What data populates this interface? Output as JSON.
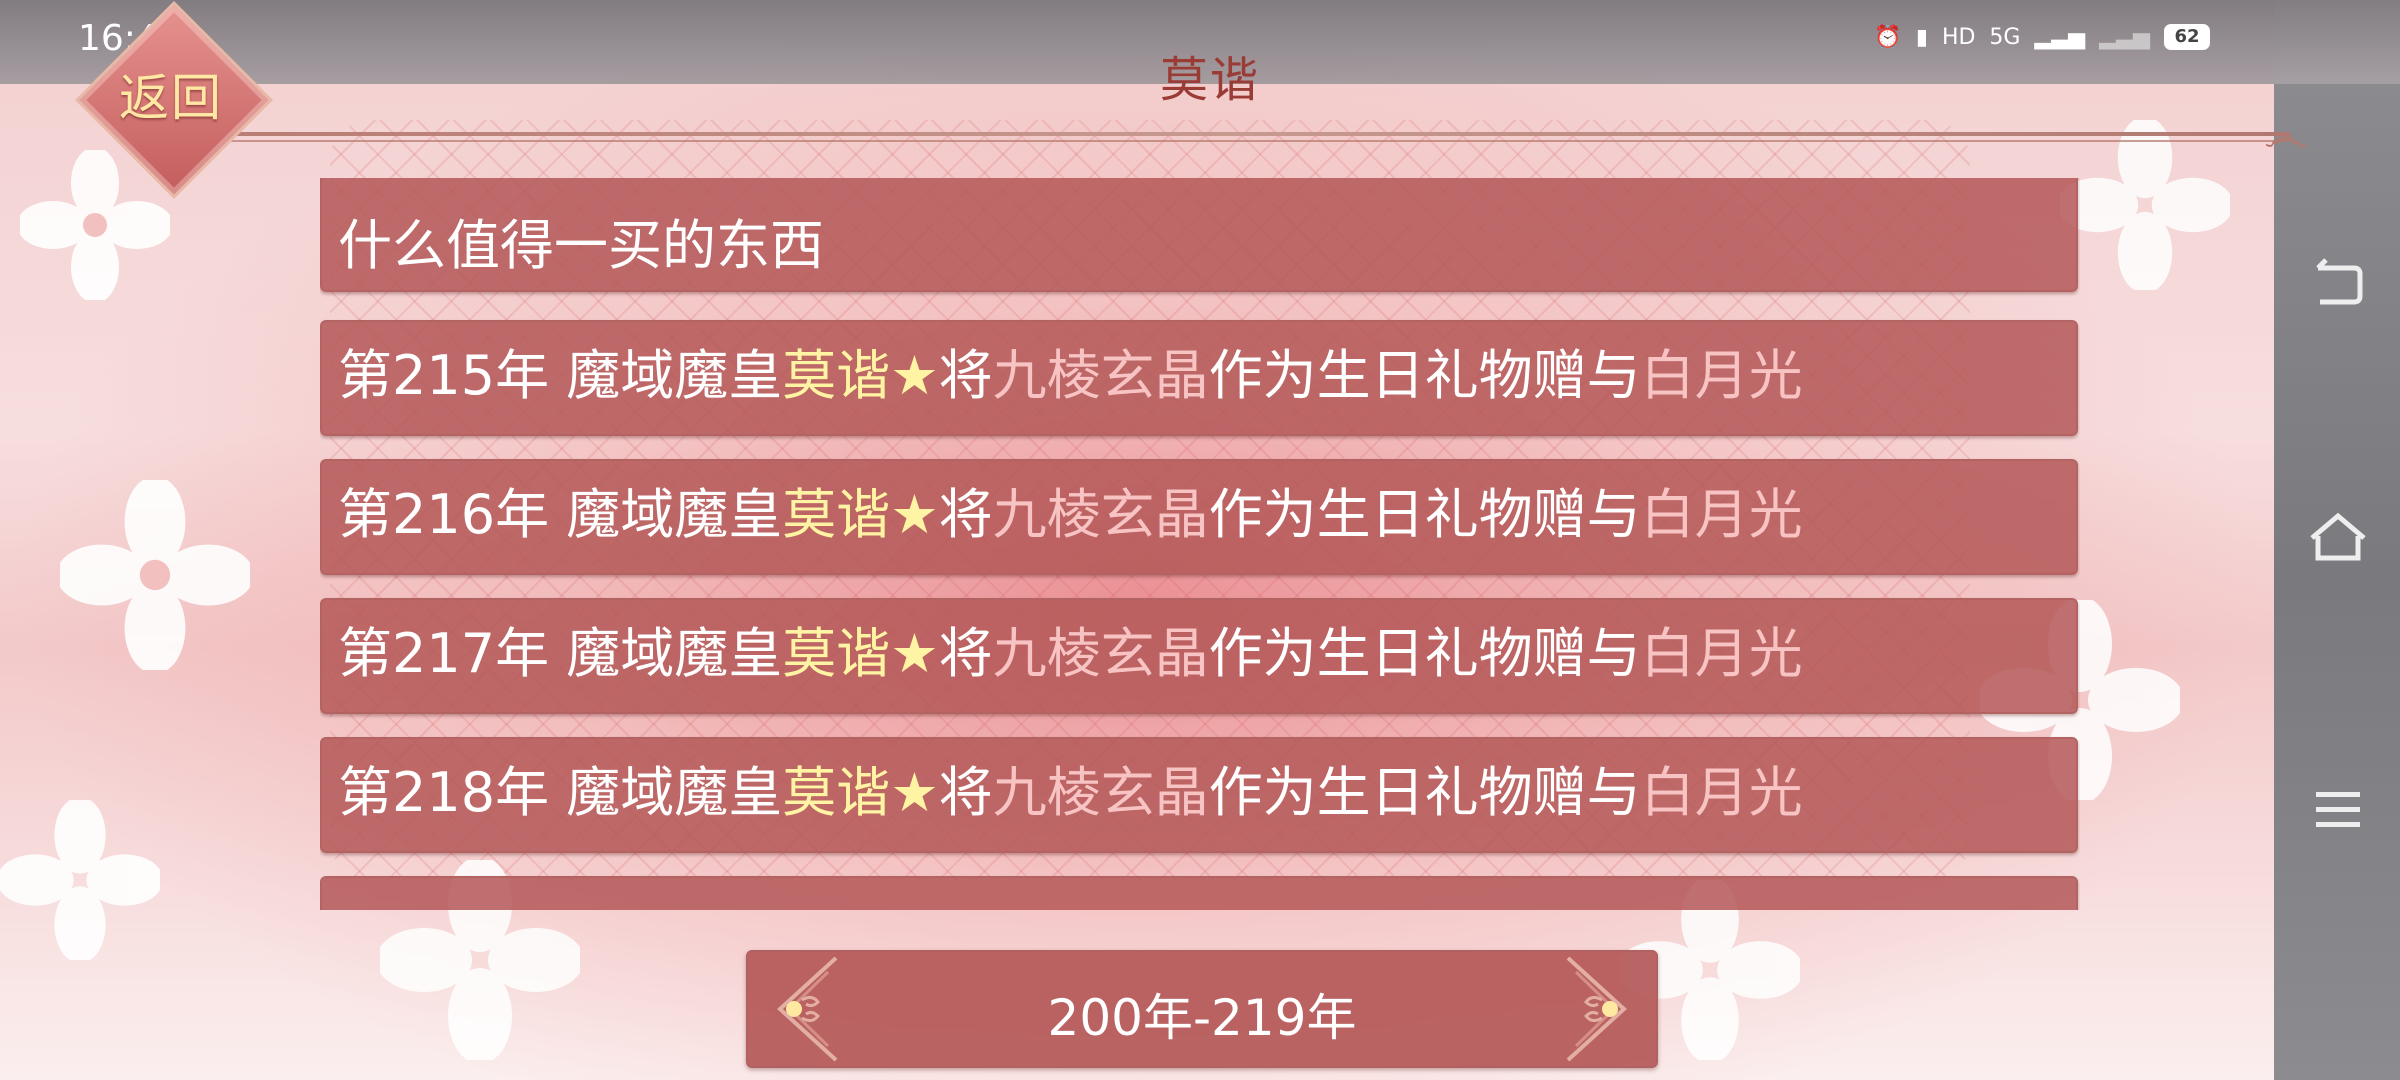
{
  "status_bar": {
    "time": "16:44",
    "network": "5G",
    "hd": "HD",
    "battery": "62"
  },
  "header": {
    "back_label": "返回",
    "title": "莫谐"
  },
  "list": {
    "partial_top": "什么值得一买的东西",
    "items": [
      {
        "year": "第215年",
        "text1": " 魔域魔皇",
        "name": "莫谐",
        "star": "★",
        "text2": "将",
        "item": "九棱玄晶",
        "text3": "作为生日礼物赠与",
        "target": "白月光"
      },
      {
        "year": "第216年",
        "text1": " 魔域魔皇",
        "name": "莫谐",
        "star": "★",
        "text2": "将",
        "item": "九棱玄晶",
        "text3": "作为生日礼物赠与",
        "target": "白月光"
      },
      {
        "year": "第217年",
        "text1": " 魔域魔皇",
        "name": "莫谐",
        "star": "★",
        "text2": "将",
        "item": "九棱玄晶",
        "text3": "作为生日礼物赠与",
        "target": "白月光"
      },
      {
        "year": "第218年",
        "text1": " 魔域魔皇",
        "name": "莫谐",
        "star": "★",
        "text2": "将",
        "item": "九棱玄晶",
        "text3": "作为生日礼物赠与",
        "target": "白月光"
      }
    ]
  },
  "pager": {
    "label": "200年-219年"
  },
  "colors": {
    "row_bg": "#b45858",
    "highlight_name": "#fff3a4",
    "highlight_item": "#f7c3c3",
    "title": "#9b3b36"
  }
}
